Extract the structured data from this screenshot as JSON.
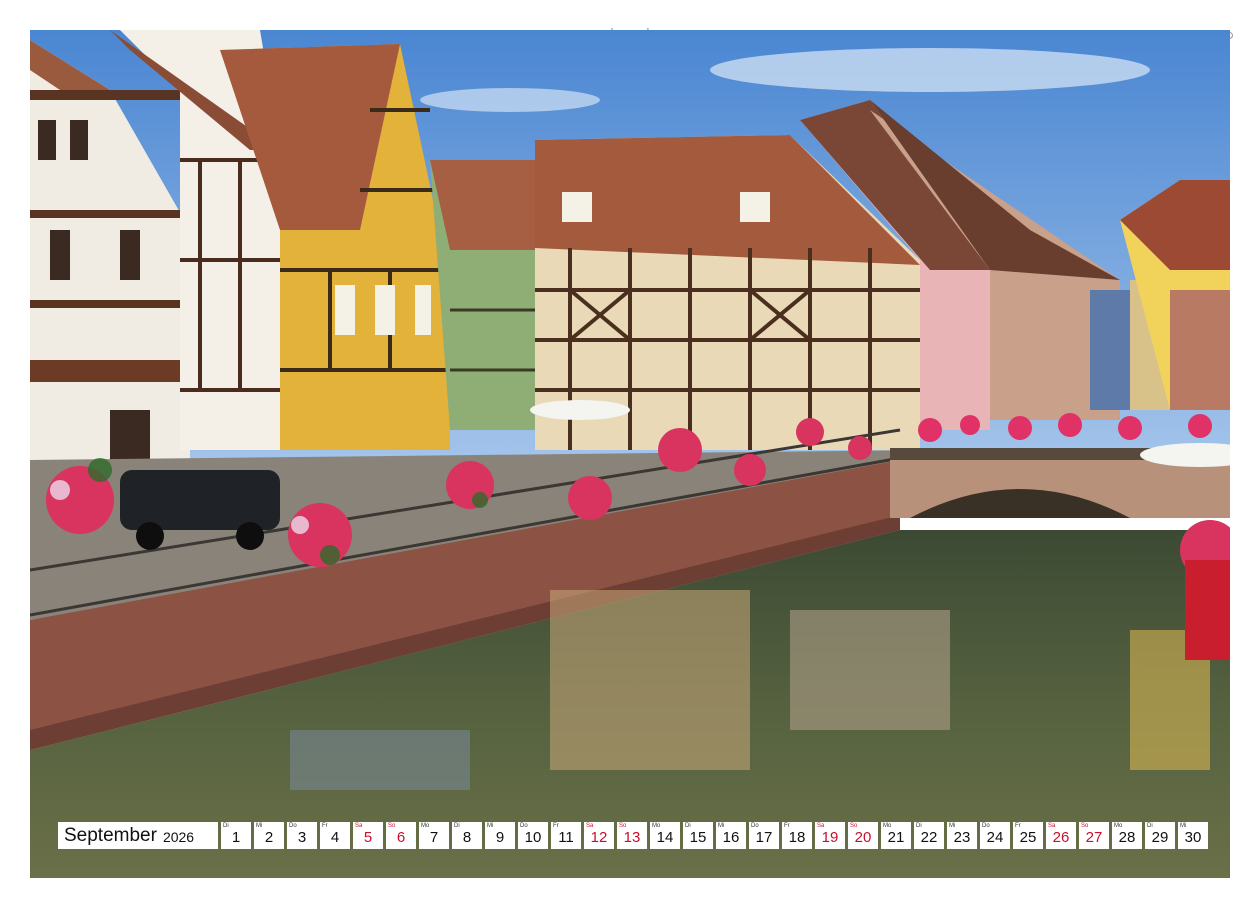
{
  "calendar": {
    "month": "September",
    "year": "2026",
    "weekend_color": "#c8102e",
    "days": [
      {
        "wd": "Di",
        "n": "1",
        "we": false
      },
      {
        "wd": "Mi",
        "n": "2",
        "we": false
      },
      {
        "wd": "Do",
        "n": "3",
        "we": false
      },
      {
        "wd": "Fr",
        "n": "4",
        "we": false
      },
      {
        "wd": "Sa",
        "n": "5",
        "we": true
      },
      {
        "wd": "So",
        "n": "6",
        "we": true
      },
      {
        "wd": "Mo",
        "n": "7",
        "we": false
      },
      {
        "wd": "Di",
        "n": "8",
        "we": false
      },
      {
        "wd": "Mi",
        "n": "9",
        "we": false
      },
      {
        "wd": "Do",
        "n": "10",
        "we": false
      },
      {
        "wd": "Fr",
        "n": "11",
        "we": false
      },
      {
        "wd": "Sa",
        "n": "12",
        "we": true
      },
      {
        "wd": "So",
        "n": "13",
        "we": true
      },
      {
        "wd": "Mo",
        "n": "14",
        "we": false
      },
      {
        "wd": "Di",
        "n": "15",
        "we": false
      },
      {
        "wd": "Mi",
        "n": "16",
        "we": false
      },
      {
        "wd": "Do",
        "n": "17",
        "we": false
      },
      {
        "wd": "Fr",
        "n": "18",
        "we": false
      },
      {
        "wd": "Sa",
        "n": "19",
        "we": true
      },
      {
        "wd": "So",
        "n": "20",
        "we": true
      },
      {
        "wd": "Mo",
        "n": "21",
        "we": false
      },
      {
        "wd": "Di",
        "n": "22",
        "we": false
      },
      {
        "wd": "Mi",
        "n": "23",
        "we": false
      },
      {
        "wd": "Do",
        "n": "24",
        "we": false
      },
      {
        "wd": "Fr",
        "n": "25",
        "we": false
      },
      {
        "wd": "Sa",
        "n": "26",
        "we": true
      },
      {
        "wd": "So",
        "n": "27",
        "we": true
      },
      {
        "wd": "Mo",
        "n": "28",
        "we": false
      },
      {
        "wd": "Di",
        "n": "29",
        "we": false
      },
      {
        "wd": "Mi",
        "n": "30",
        "we": false
      }
    ]
  },
  "photo": {
    "description_icon": "photo-canal-half-timbered-houses",
    "colors": {
      "sky": "#5b93d6",
      "water": "#4a5a3e",
      "wall": "#9b5b4a",
      "yellow_house": "#e2b23a",
      "green_house": "#8fae76",
      "flowers": "#d8345f"
    }
  }
}
